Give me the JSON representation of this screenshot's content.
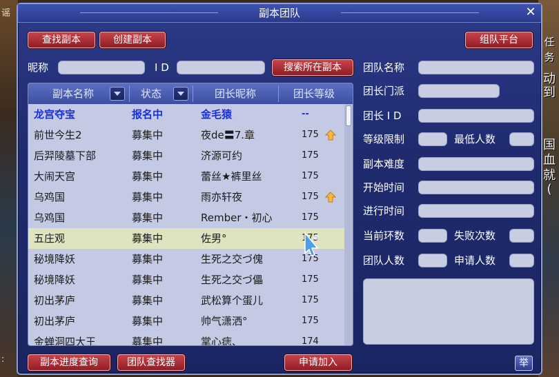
{
  "window": {
    "title": "副本团队",
    "close_label": "✕"
  },
  "toolbar": {
    "find_label": "查找副本",
    "create_label": "创建副本",
    "platform_label": "组队平台"
  },
  "search": {
    "nickname_label": "昵称",
    "id_label": "I D",
    "search_button": "搜索所在副本",
    "nickname_value": "",
    "id_value": ""
  },
  "table": {
    "columns": [
      "副本名称",
      "状态",
      "团长昵称",
      "团长等级"
    ],
    "rows": [
      {
        "name": "龙宫夺宝",
        "status": "报名中",
        "leader": "金毛猿",
        "level": "--",
        "up": false,
        "style": "signup"
      },
      {
        "name": "前世今生2",
        "status": "募集中",
        "leader": "夜de〓7.章",
        "level": "175",
        "up": true,
        "style": ""
      },
      {
        "name": "后羿陵墓下部",
        "status": "募集中",
        "leader": "济源可约",
        "level": "175",
        "up": false,
        "style": ""
      },
      {
        "name": "大闹天宫",
        "status": "募集中",
        "leader": "蕾丝★裤里丝",
        "level": "175",
        "up": false,
        "style": ""
      },
      {
        "name": "乌鸡国",
        "status": "募集中",
        "leader": "雨亦轩夜",
        "level": "175",
        "up": true,
        "style": ""
      },
      {
        "name": "乌鸡国",
        "status": "募集中",
        "leader": "Rember・初心",
        "level": "175",
        "up": false,
        "style": ""
      },
      {
        "name": "五庄观",
        "status": "募集中",
        "leader": "佐男°",
        "level": "175",
        "up": false,
        "style": "selected"
      },
      {
        "name": "秘境降妖",
        "status": "募集中",
        "leader": "生死之交づ傀",
        "level": "175",
        "up": false,
        "style": ""
      },
      {
        "name": "秘境降妖",
        "status": "募集中",
        "leader": "生死之交づ儡",
        "level": "175",
        "up": false,
        "style": ""
      },
      {
        "name": "初出茅庐",
        "status": "募集中",
        "leader": "武松算个蛋儿",
        "level": "175",
        "up": false,
        "style": ""
      },
      {
        "name": "初出茅庐",
        "status": "募集中",
        "leader": "帅气潇洒°",
        "level": "175",
        "up": false,
        "style": ""
      },
      {
        "name": "金蝉洞四大王",
        "status": "募集中",
        "leader": "掌心痣、",
        "level": "174",
        "up": false,
        "style": ""
      }
    ]
  },
  "details": {
    "team_name": "团队名称",
    "leader_school": "团长门派",
    "leader_id": "团长 I D",
    "level_limit": "等级限制",
    "min_members": "最低人数",
    "difficulty": "副本难度",
    "start_time": "开始时间",
    "elapsed_time": "进行时间",
    "current_round": "当前环数",
    "fail_count": "失败次数",
    "team_size": "团队人数",
    "applicants": "申请人数"
  },
  "bottom": {
    "progress_label": "副本进度查询",
    "finder_label": "团队查找器",
    "apply_label": "申请加入",
    "report_label": "举"
  },
  "background": {
    "right_text": [
      "任务",
      "动",
      "到",
      "国",
      "血",
      "就",
      "("
    ],
    "left_text": [
      "谣",
      ":"
    ]
  },
  "colors": {
    "window": "#1f2b6e",
    "button_red": "#b03038",
    "field": "#c8cde2",
    "signup_text": "#1b2fd6",
    "selected_row": "#dfe3bf"
  }
}
